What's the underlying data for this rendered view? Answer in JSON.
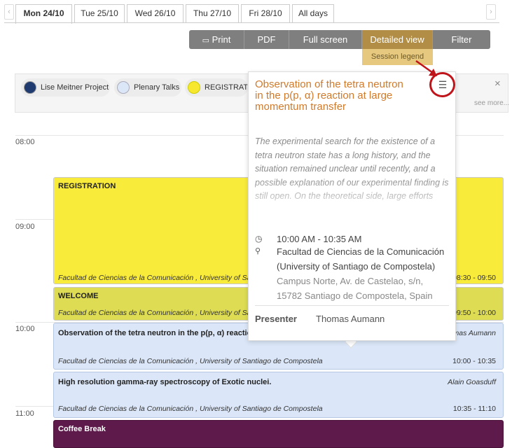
{
  "days": {
    "prev_arrow": "‹",
    "next_arrow": "›",
    "tabs": [
      "Mon 24/10",
      "Tue 25/10",
      "Wed 26/10",
      "Thu 27/10",
      "Fri 28/10",
      "All days"
    ]
  },
  "toolbar": {
    "print": "Print",
    "pdf": "PDF",
    "fullscreen": "Full screen",
    "detailed": "Detailed view",
    "filter": "Filter",
    "session_legend": "Session legend"
  },
  "legend": {
    "items": [
      {
        "label": "Lise Meitner Project",
        "color": "#1e3a6e"
      },
      {
        "label": "Plenary Talks",
        "color": "#dbe7f7"
      },
      {
        "label": "REGISTRATION",
        "color": "#f7e82f"
      }
    ],
    "close": "×",
    "see_more": "see more..."
  },
  "hours": [
    "08:00",
    "09:00",
    "10:00",
    "11:00"
  ],
  "events": [
    {
      "title": "REGISTRATION",
      "location": "Facultad de Ciencias de la Comunicación , University of Santiago de Compostela",
      "time": "08:30 - 09:50",
      "color": "#f9eb3a"
    },
    {
      "title": "WELCOME",
      "location": "Facultad de Ciencias de la Comunicación , University of Santiago de Compostela",
      "time": "09:50 - 10:00",
      "color": "#dddc52"
    },
    {
      "title": "Observation of the tetra neutron in the p(p, α) reaction at large momentum transfer",
      "presenter": "Thomas Aumann",
      "location": "Facultad de Ciencias de la Comunicación , University of Santiago de Compostela",
      "time": "10:00 - 10:35",
      "color": "#dbe7f8"
    },
    {
      "title": "High resolution gamma-ray spectroscopy of Exotic nuclei.",
      "presenter": "Alain Goasduff",
      "location": "Facultad de Ciencias de la Comunicación , University of Santiago de Compostela",
      "time": "10:35 - 11:10",
      "color": "#dbe7f8"
    },
    {
      "title": "Coffee Break",
      "color": "#5d1a4a"
    }
  ],
  "popup": {
    "title": "Observation of the tetra neutron in the p(p, α) reaction at large momentum transfer",
    "description": "The experimental search for the existence of a tetra neutron state has a long history, and the situation remained unclear until recently, and a possible explanation of our experimental finding is still open. On the theoretical side, large efforts",
    "time": "10:00 AM - 10:35 AM",
    "venue_line1": "Facultad de Ciencias de la Comunicación",
    "venue_line2": "(University of Santiago de Compostela)",
    "address_line1": "Campus Norte, Av. de Castelao, s/n,",
    "address_line2": "15782 Santiago de Compostela, Spain",
    "presenter_label": "Presenter",
    "presenter": "Thomas Aumann"
  },
  "colors": {
    "accent_orange": "#d07a2b",
    "annotation_red": "#c0141b",
    "toolbar_gray": "#7f7f7f",
    "toolbar_active": "#b28d45"
  }
}
